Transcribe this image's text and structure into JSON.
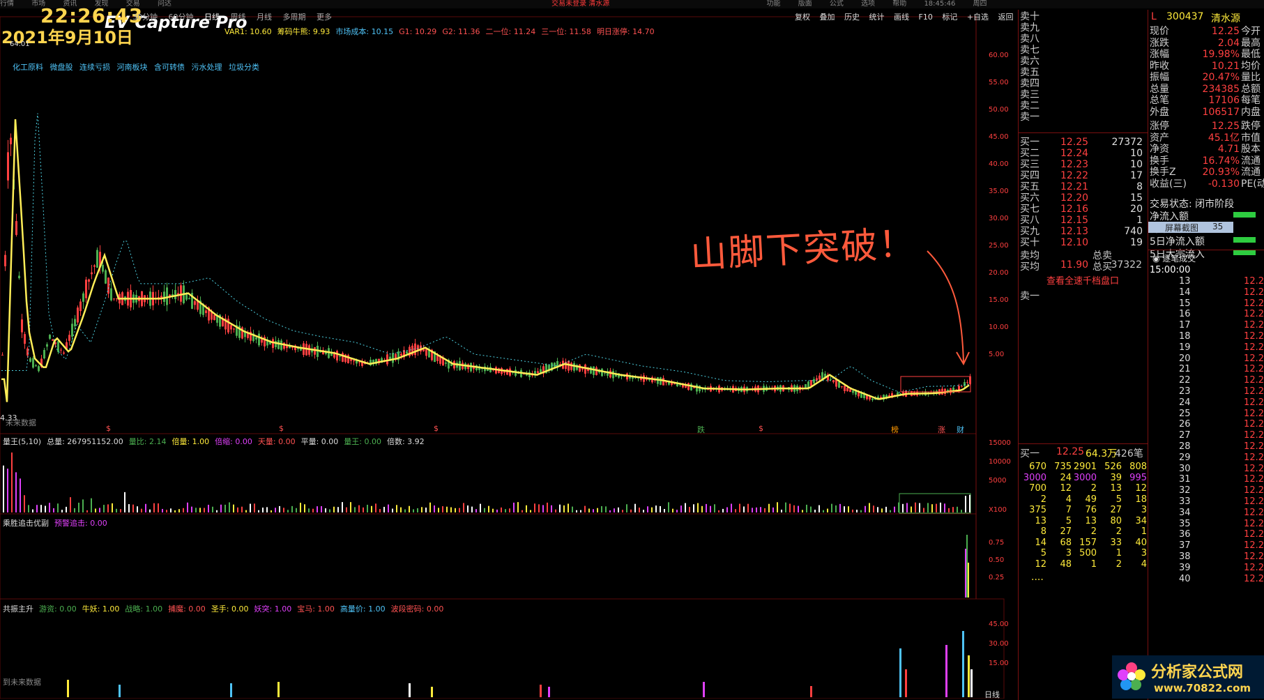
{
  "menu": [
    "行情",
    "市场",
    "资讯",
    "发现",
    "交易",
    "问达"
  ],
  "menu_warn": "交易未登录   清水源",
  "menu_right": [
    "功能",
    "版面",
    "公式",
    "选项",
    "帮助",
    "18:45:46",
    "周四"
  ],
  "clock": "22:26:43",
  "date": "2021年9月10日",
  "watermark": "EV Capture Pro",
  "timeframes": [
    "30分钟",
    "60分钟",
    "日线",
    "周线",
    "月线",
    "多周期",
    "更多"
  ],
  "toolbar": [
    "复权",
    "叠加",
    "历史",
    "统计",
    "画线",
    "F10",
    "标记",
    "+自选",
    "返回"
  ],
  "stats": [
    {
      "t": "VAR1: 10.60",
      "c": "#ffeb3b"
    },
    {
      "t": "筹码牛熊: 9.93",
      "c": "#ffeb3b"
    },
    {
      "t": "市场成本: 10.15",
      "c": "#4fc3f7"
    },
    {
      "t": "G1: 10.29",
      "c": "#ff5252"
    },
    {
      "t": "G2: 11.36",
      "c": "#ff5252"
    },
    {
      "t": "二一位: 11.24",
      "c": "#ff5252"
    },
    {
      "t": "三一位: 11.58",
      "c": "#ff5252"
    },
    {
      "t": "明日涨停: 14.70",
      "c": "#ff5252"
    }
  ],
  "concepts": [
    "化工原料",
    "微盘股",
    "连续亏损",
    "河南板块",
    "含可转债",
    "污水处理",
    "垃圾分类"
  ],
  "price_axis": [
    "60.00",
    "55.00",
    "50.00",
    "45.00",
    "40.00",
    "35.00",
    "30.00",
    "25.00",
    "20.00",
    "15.00",
    "10.00",
    "5.00"
  ],
  "annotation": "山脚下突破！",
  "peak_label": "64.01",
  "low_label": "4.33",
  "no_data": "未来数据",
  "no_data2": "到未来数据",
  "event_marks": [
    {
      "t": "$",
      "c": "#ff5252"
    },
    {
      "t": "$",
      "c": "#ff5252"
    },
    {
      "t": "$",
      "c": "#ff5252"
    },
    {
      "t": "跌",
      "c": "#4caf50"
    },
    {
      "t": "$",
      "c": "#ff5252"
    },
    {
      "t": "榜",
      "c": "#ff9800"
    },
    {
      "t": "涨",
      "c": "#ff5252"
    },
    {
      "t": "财",
      "c": "#4fc3f7"
    }
  ],
  "vol_header": [
    {
      "t": "量王(5,10)",
      "c": "#ddd"
    },
    {
      "t": "总量: 267951152.00",
      "c": "#ddd"
    },
    {
      "t": "量比: 2.14",
      "c": "#4caf50"
    },
    {
      "t": "倍量: 1.00",
      "c": "#ffeb3b"
    },
    {
      "t": "倍缩: 0.00",
      "c": "#e040fb"
    },
    {
      "t": "天量: 0.00",
      "c": "#ff5252"
    },
    {
      "t": "平量: 0.00",
      "c": "#ddd"
    },
    {
      "t": "量王: 0.00",
      "c": "#4caf50"
    },
    {
      "t": "倍数: 3.92",
      "c": "#ddd"
    }
  ],
  "vol_axis": [
    "15000",
    "10000",
    "5000"
  ],
  "vol_unit": "X100",
  "ind1_header": [
    {
      "t": "乘胜追击优副",
      "c": "#ddd"
    },
    {
      "t": "预警追击: 0.00",
      "c": "#e040fb"
    }
  ],
  "ind1_axis": [
    "0.75",
    "0.50",
    "0.25"
  ],
  "ind2_header": [
    {
      "t": "共振主升",
      "c": "#ddd"
    },
    {
      "t": "游资: 0.00",
      "c": "#4caf50"
    },
    {
      "t": "牛妖: 1.00",
      "c": "#ffeb3b"
    },
    {
      "t": "战略: 1.00",
      "c": "#4caf50"
    },
    {
      "t": "捕魔: 0.00",
      "c": "#ff5252"
    },
    {
      "t": "圣手: 0.00",
      "c": "#ffeb3b"
    },
    {
      "t": "妖突: 1.00",
      "c": "#e040fb"
    },
    {
      "t": "宝马: 1.00",
      "c": "#ff5252"
    },
    {
      "t": "高量价: 1.00",
      "c": "#4fc3f7"
    },
    {
      "t": "波段密码: 0.00",
      "c": "#ff5252"
    }
  ],
  "ind2_axis": [
    "45.00",
    "30.00",
    "15.00"
  ],
  "period_label": "日线",
  "orderbook": {
    "sells": [
      "卖十",
      "卖九",
      "卖八",
      "卖七",
      "卖六",
      "卖五",
      "卖四",
      "卖三",
      "卖二",
      "卖一"
    ],
    "buys": [
      {
        "l": "买一",
        "p": "12.25",
        "v": "27372"
      },
      {
        "l": "买二",
        "p": "12.24",
        "v": "10"
      },
      {
        "l": "买三",
        "p": "12.23",
        "v": "10"
      },
      {
        "l": "买四",
        "p": "12.22",
        "v": "17"
      },
      {
        "l": "买五",
        "p": "12.21",
        "v": "8"
      },
      {
        "l": "买六",
        "p": "12.20",
        "v": "15"
      },
      {
        "l": "买七",
        "p": "12.16",
        "v": "20"
      },
      {
        "l": "买八",
        "p": "12.15",
        "v": "1"
      },
      {
        "l": "买九",
        "p": "12.13",
        "v": "740"
      },
      {
        "l": "买十",
        "p": "12.10",
        "v": "19"
      }
    ],
    "sell_avg_label": "卖均",
    "total_sell_label": "总卖",
    "buy_avg_label": "买均",
    "buy_avg": "11.90",
    "total_buy_label": "总买",
    "total_buy": "37322",
    "full_link": "查看全速千档盘口",
    "sell1_label": "卖一",
    "buy1_label": "买一",
    "buy1_price": "12.25",
    "buy1_amt": "64.3万",
    "buy1_count": "426笔",
    "queue": [
      [
        "670",
        "735",
        "2901",
        "526",
        "808"
      ],
      [
        "3000",
        "24",
        "3000",
        "39",
        "995"
      ],
      [
        "700",
        "12",
        "2",
        "13",
        "12"
      ],
      [
        "2",
        "4",
        "49",
        "5",
        "18"
      ],
      [
        "375",
        "7",
        "76",
        "27",
        "3"
      ],
      [
        "13",
        "5",
        "13",
        "80",
        "34"
      ],
      [
        "8",
        "27",
        "2",
        "2",
        "1"
      ],
      [
        "14",
        "68",
        "157",
        "33",
        "40"
      ],
      [
        "5",
        "3",
        "500",
        "1",
        "3"
      ],
      [
        "12",
        "48",
        "1",
        "2",
        "4"
      ]
    ],
    "queue_more": "...."
  },
  "quote": {
    "head_left": "L",
    "code": "300437",
    "name": "清水源",
    "rows": [
      [
        "现价",
        "12.25",
        "今开"
      ],
      [
        "涨跌",
        "2.04",
        "最高"
      ],
      [
        "涨幅",
        "19.98%",
        "最低"
      ],
      [
        "昨收",
        "10.21",
        "均价"
      ],
      [
        "振幅",
        "20.47%",
        "量比"
      ],
      [
        "总量",
        "234385",
        "总额"
      ],
      [
        "总笔",
        "17106",
        "每笔"
      ],
      [
        "外盘",
        "106517",
        "内盘"
      ],
      [
        "涨停",
        "12.25",
        "跌停"
      ],
      [
        "资产",
        "45.1亿",
        "市值"
      ],
      [
        "净资",
        "4.71",
        "股本"
      ],
      [
        "换手",
        "16.74%",
        "流通"
      ],
      [
        "换手Z",
        "20.93%",
        "流通"
      ],
      [
        "收益(三)",
        "-0.130",
        "PE(动"
      ]
    ],
    "status": "交易状态: 闭市阶段",
    "flow_rows": [
      "净流入额",
      "屏幕截图",
      "5日净流入额",
      "5日大宗流入"
    ],
    "screenshot_badge": "35",
    "ticks_title": "逐笔成交",
    "tick_time": "15:00:00",
    "tick_rows": [
      "13",
      "14",
      "15",
      "16",
      "17",
      "18",
      "19",
      "20",
      "21",
      "22",
      "23",
      "24",
      "25",
      "26",
      "27",
      "28",
      "29",
      "30",
      "31",
      "32",
      "33",
      "34",
      "35",
      "36",
      "37",
      "38",
      "39",
      "40"
    ],
    "tick_price": "12.2"
  },
  "logo_cn": "分析家公式网",
  "logo_url": "www.70822.com",
  "colors": {
    "up": "#ff4040",
    "down": "#4caf50",
    "ma": "#ffee58",
    "bg": "#000000",
    "axis": "#7a1010"
  }
}
